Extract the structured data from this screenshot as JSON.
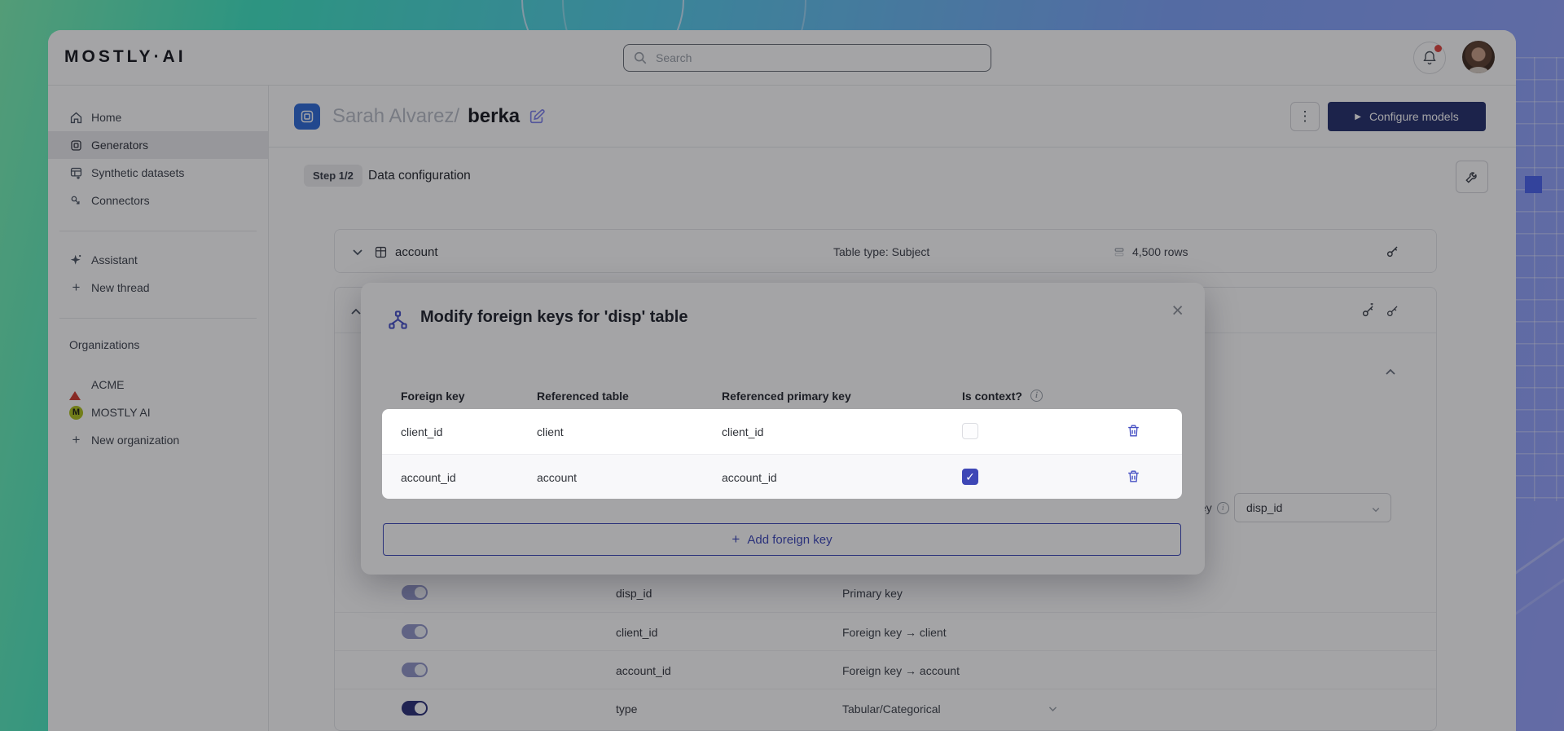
{
  "brand": {
    "logo_text": "MOSTLY·AI"
  },
  "topbar": {
    "search_placeholder": "Search"
  },
  "icons": {
    "plus": "+",
    "kebab": "⋮",
    "play": "▶",
    "close": "×",
    "check": "✓",
    "info_letter": "i"
  },
  "sidebar": {
    "items": [
      "Home",
      "Generators",
      "Synthetic datasets",
      "Connectors"
    ],
    "tools": [
      "Assistant",
      "New thread"
    ],
    "organizations_label": "Organizations",
    "organizations": [
      "ACME",
      "MOSTLY AI"
    ],
    "mostly_badge_letter": "M",
    "new_organization": "New organization"
  },
  "header": {
    "owner": "Sarah Alvarez/",
    "generator_name": "berka",
    "configure_models": "Configure models"
  },
  "step": {
    "badge": "Step 1/2",
    "title": "Data configuration"
  },
  "account_card": {
    "name": "account",
    "table_type": "Table type: Subject",
    "row_count": "4,500 rows"
  },
  "disp_card": {
    "primary_key_label_partial": "ey",
    "primary_key_value": "disp_id",
    "columns": [
      {
        "name": "disp_id",
        "encoding": "Primary key"
      },
      {
        "name": "client_id",
        "encoding": "Foreign key → client"
      },
      {
        "name": "account_id",
        "encoding": "Foreign key → account"
      },
      {
        "name": "type",
        "encoding": "Tabular/Categorical"
      }
    ]
  },
  "modal": {
    "title": "Modify foreign keys for 'disp' table",
    "headers": [
      "Foreign key",
      "Referenced table",
      "Referenced primary key",
      "Is context?"
    ],
    "rows": [
      {
        "foreign_key": "client_id",
        "referenced_table": "client",
        "referenced_primary_key": "client_id",
        "is_context": false
      },
      {
        "foreign_key": "account_id",
        "referenced_table": "account",
        "referenced_primary_key": "account_id",
        "is_context": true
      }
    ],
    "add_foreign_key": "Add foreign key"
  },
  "colors": {
    "accent": "#3d47ba",
    "primary_button": "#242f6d",
    "checkbox_checked": "#3e47b6",
    "gen_icon_bg": "#2e6bd8"
  }
}
